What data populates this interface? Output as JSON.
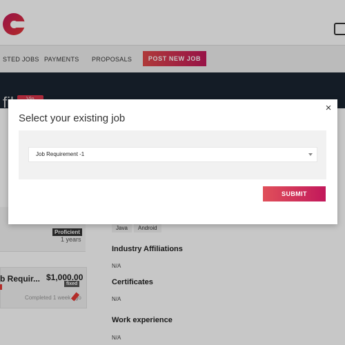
{
  "nav": {
    "items": [
      "STED JOBS",
      "PAYMENTS",
      "PROPOSALS"
    ],
    "post_job_label": "POST NEW JOB"
  },
  "header": {
    "title_partial": "file",
    "badge": "Vin"
  },
  "profile": {
    "skill_level": "Proficient",
    "skill_years": "1 years",
    "skills": [
      "Java",
      "Android"
    ],
    "sections": [
      {
        "title": "Industry Affiliations",
        "value": "N/A"
      },
      {
        "title": "Certificates",
        "value": "N/A"
      },
      {
        "title": "Work experience",
        "value": "N/A"
      }
    ]
  },
  "job_card": {
    "title": "b Requir...",
    "price": "$1,000.00",
    "type": "fixed",
    "status": "Completed 1 week ago"
  },
  "modal": {
    "title": "Select your existing job",
    "selected_job": "Job Requirement -1",
    "submit_label": "SUBMIT",
    "close_symbol": "×"
  },
  "colors": {
    "accent_start": "#e0505a",
    "accent_end": "#c2185b",
    "dark_band": "#1a2431"
  }
}
